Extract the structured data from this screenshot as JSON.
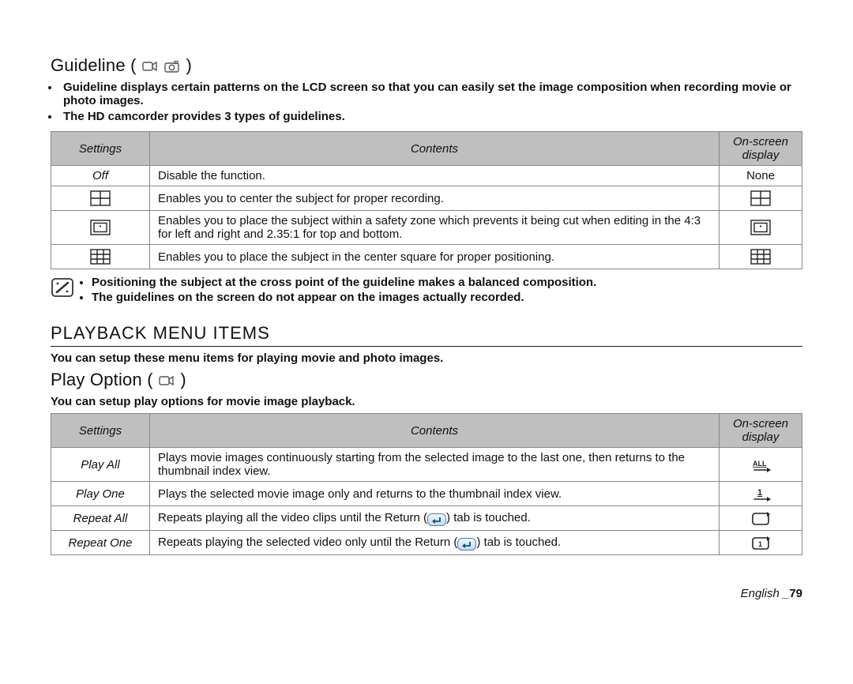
{
  "guideline": {
    "title": "Guideline (",
    "title_suffix": " )",
    "bullets": [
      "Guideline displays certain patterns on the LCD screen so that you can easily set the image composition when recording movie or photo images.",
      "The HD camcorder provides 3 types of guidelines."
    ],
    "table_headers": {
      "settings": "Settings",
      "contents": "Contents",
      "osd": "On-screen display"
    },
    "rows": [
      {
        "setting": "Off",
        "icon": "none",
        "contents": "Disable the function.",
        "osd_text": "None",
        "osd_icon": "none"
      },
      {
        "setting": "",
        "icon": "cross",
        "contents": "Enables you to center the subject for proper recording.",
        "osd_text": "",
        "osd_icon": "cross"
      },
      {
        "setting": "",
        "icon": "safety",
        "contents": "Enables you to place the subject within a safety zone which prevents it being cut when editing in the 4:3 for left and right and 2.35:1 for top and bottom.",
        "osd_text": "",
        "osd_icon": "safety"
      },
      {
        "setting": "",
        "icon": "grid",
        "contents": "Enables you to place the subject in the center square for proper positioning.",
        "osd_text": "",
        "osd_icon": "grid"
      }
    ],
    "note": [
      "Positioning the subject at the cross point of the guideline makes a balanced composition.",
      "The guidelines on the screen do not appear on the images actually recorded."
    ]
  },
  "playback": {
    "title": "PLAYBACK MENU ITEMS",
    "intro": "You can setup these menu items for playing movie and photo images."
  },
  "playoption": {
    "title": "Play Option (",
    "title_suffix": " )",
    "intro": "You can setup play options for movie image playback.",
    "table_headers": {
      "settings": "Settings",
      "contents": "Contents",
      "osd": "On-screen display"
    },
    "rows": [
      {
        "setting": "Play All",
        "contents": "Plays movie images continuously starting from the selected image to the last one, then returns to the thumbnail index view.",
        "osd_icon": "play-all",
        "inline_return": false
      },
      {
        "setting": "Play One",
        "contents": "Plays the selected movie image only and returns to the thumbnail index view.",
        "osd_icon": "play-one",
        "inline_return": false
      },
      {
        "setting": "Repeat All",
        "contents_pre": "Repeats playing all the video clips until the Return (",
        "contents_post": ") tab is touched.",
        "osd_icon": "repeat-all",
        "inline_return": true
      },
      {
        "setting": "Repeat One",
        "contents_pre": "Repeats playing the selected video only until the Return (",
        "contents_post": ") tab is touched.",
        "osd_icon": "repeat-one",
        "inline_return": true
      }
    ]
  },
  "footer": {
    "lang": "English _",
    "page": "79"
  }
}
